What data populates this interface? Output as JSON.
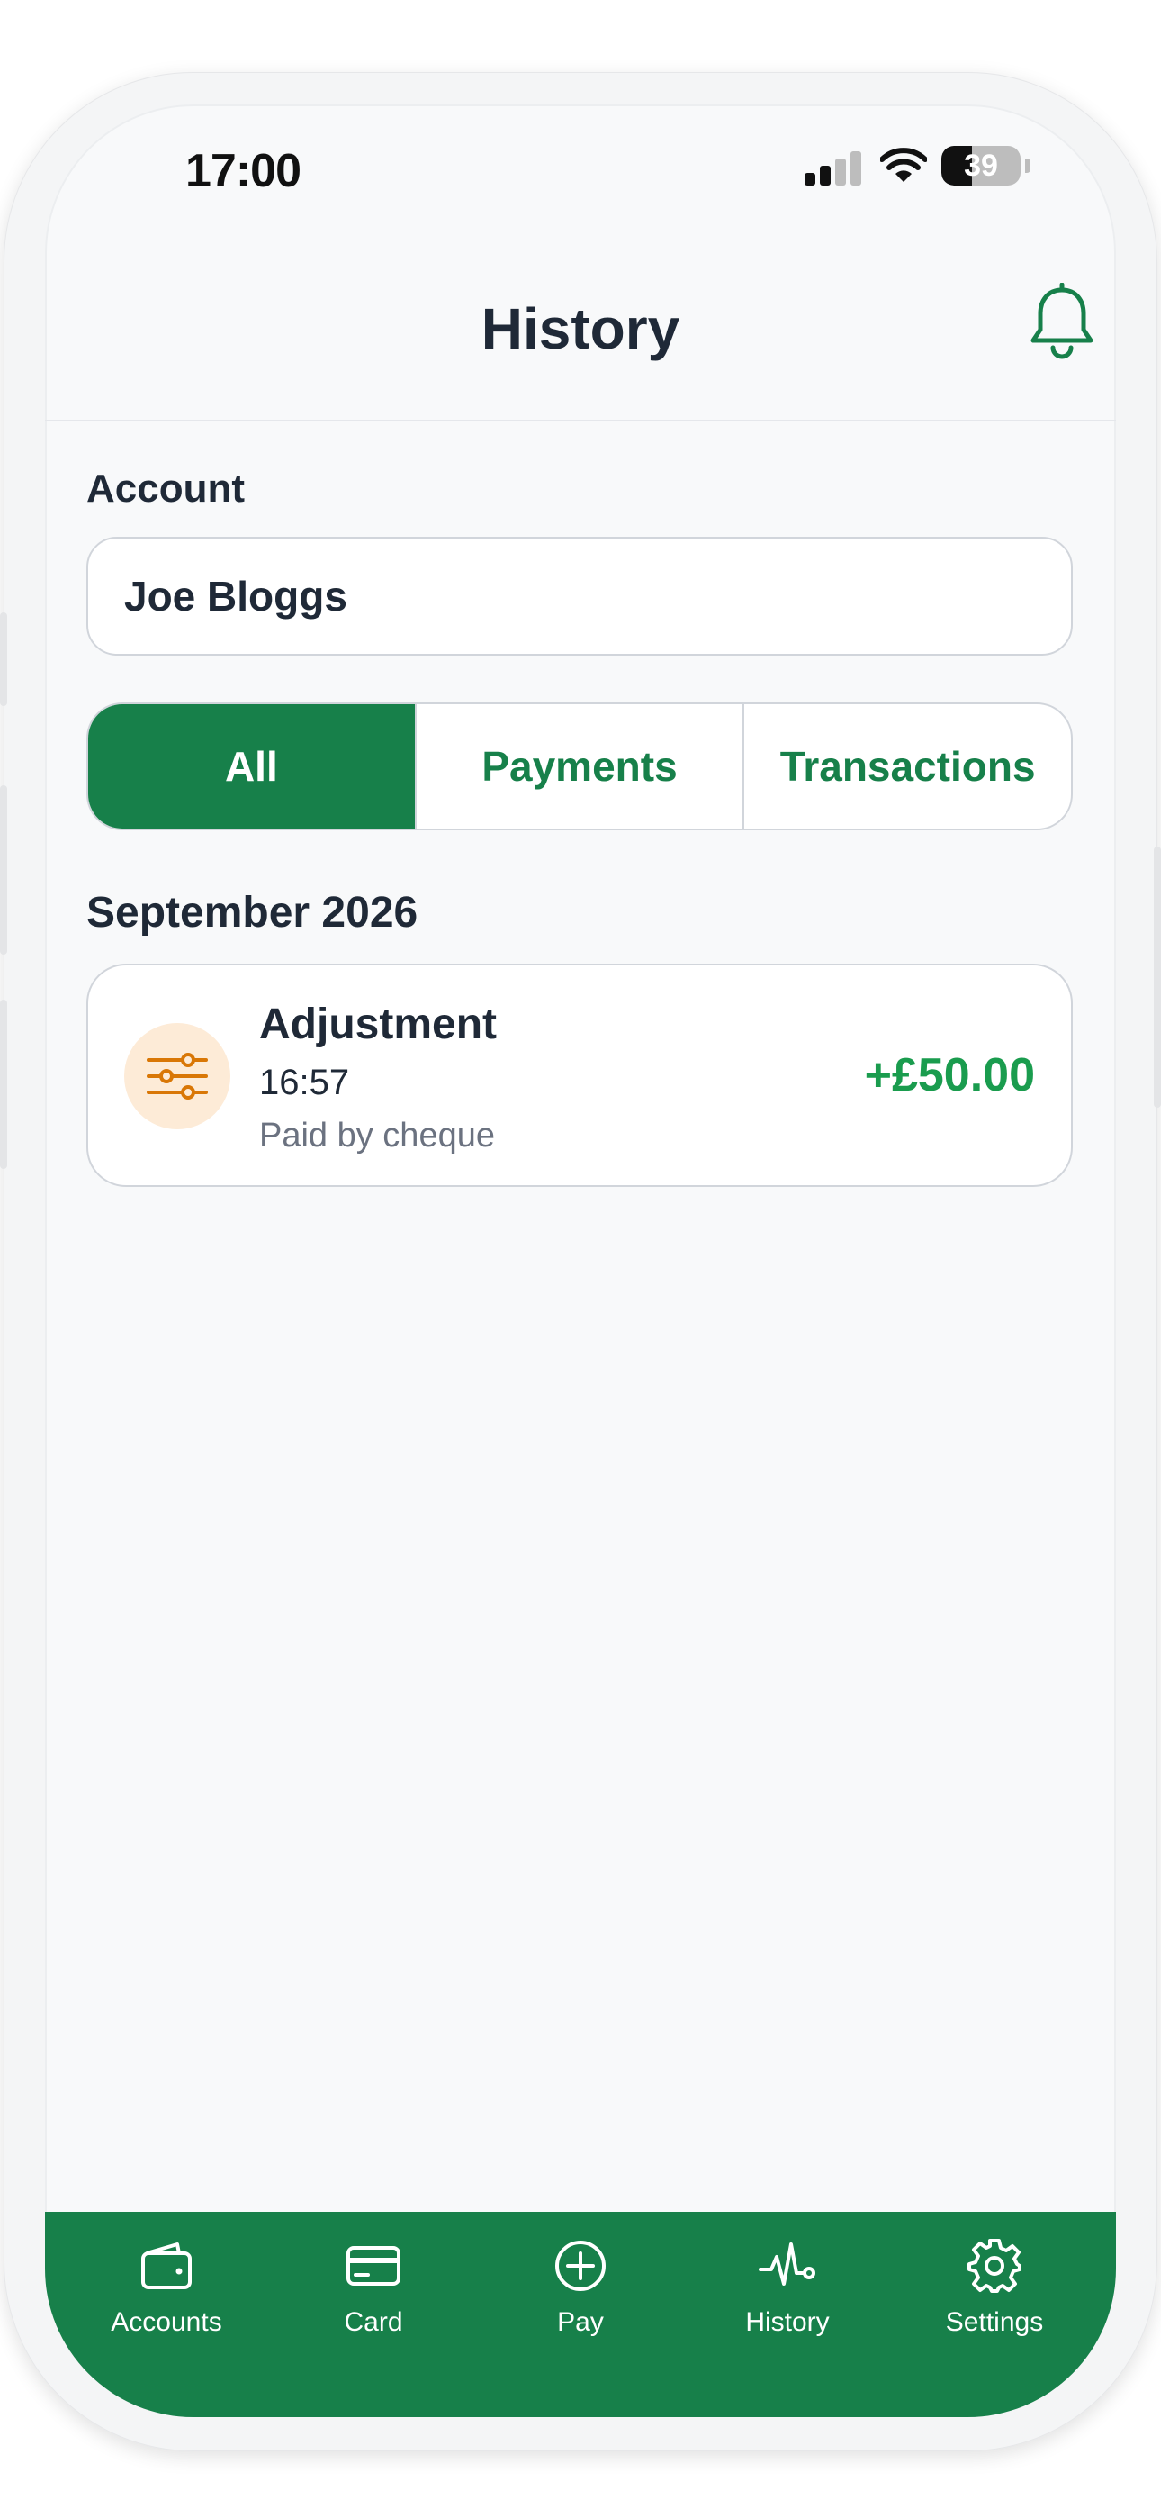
{
  "status_bar": {
    "time": "17:00",
    "battery": "39"
  },
  "header": {
    "title": "History"
  },
  "account": {
    "label": "Account",
    "selected": "Joe Bloggs"
  },
  "filters": [
    {
      "label": "All",
      "active": true
    },
    {
      "label": "Payments",
      "active": false
    },
    {
      "label": "Transactions",
      "active": false
    }
  ],
  "sections": [
    {
      "title": "September 2026",
      "items": [
        {
          "title": "Adjustment",
          "time": "16:57",
          "note": "Paid by cheque",
          "amount": "+£50.00",
          "icon": "sliders-icon"
        }
      ]
    }
  ],
  "tabbar": [
    {
      "label": "Accounts",
      "icon": "wallet-icon"
    },
    {
      "label": "Card",
      "icon": "credit-card-icon"
    },
    {
      "label": "Pay",
      "icon": "plus-circle-icon"
    },
    {
      "label": "History",
      "icon": "activity-icon"
    },
    {
      "label": "Settings",
      "icon": "gear-icon"
    }
  ],
  "colors": {
    "brand_green": "#17804a",
    "amount_green": "#1a9c4e",
    "icon_orange": "#d97706",
    "icon_bg": "#fdebd7",
    "text_dark": "#1f2937",
    "text_muted": "#6b7280"
  }
}
